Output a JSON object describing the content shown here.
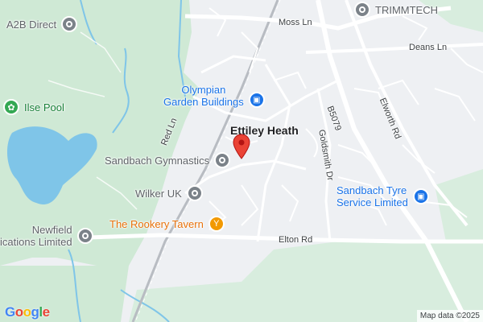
{
  "map": {
    "poi": {
      "a2b": "A2B Direct",
      "trimmtech": "TRIMMTECH",
      "olympian_line1": "Olympian",
      "olympian_line2": "Garden Buildings",
      "ilse_pool": "Ilse Pool",
      "ettiley_heath": "Ettiley Heath",
      "sandbach_gymnastics": "Sandbach Gymnastics",
      "wilker": "Wilker UK",
      "rookery_tavern": "The Rookery Tavern",
      "newfield_line1": "Newfield",
      "newfield_line2": "ications Limited",
      "tyre_line1": "Sandbach Tyre",
      "tyre_line2": "Service Limited"
    },
    "roads": {
      "moss_ln": "Moss Ln",
      "deans_ln": "Deans Ln",
      "b5079": "B5079",
      "elworth_rd": "Elworth Rd",
      "red_ln": "Red Ln",
      "goldsmith_dr": "Goldsmith Dr",
      "elton_rd": "Elton Rd"
    },
    "brand": {
      "G": "G",
      "o1": "o",
      "o2": "o",
      "g": "g",
      "l": "l",
      "e": "e"
    },
    "attribution": "Map data ©2025",
    "colors": {
      "land": "#eef0f3",
      "greenspace": "#cfe9d5",
      "water": "#7fc5e8",
      "rail": "#b8bcc2",
      "road": "#ffffff",
      "marker": "#ea4335"
    },
    "icons": {
      "business": "pin-icon",
      "shopping": "shopping-bag-icon",
      "bar": "cocktail-icon",
      "park": "flower-icon",
      "location": "red-marker-icon"
    }
  }
}
